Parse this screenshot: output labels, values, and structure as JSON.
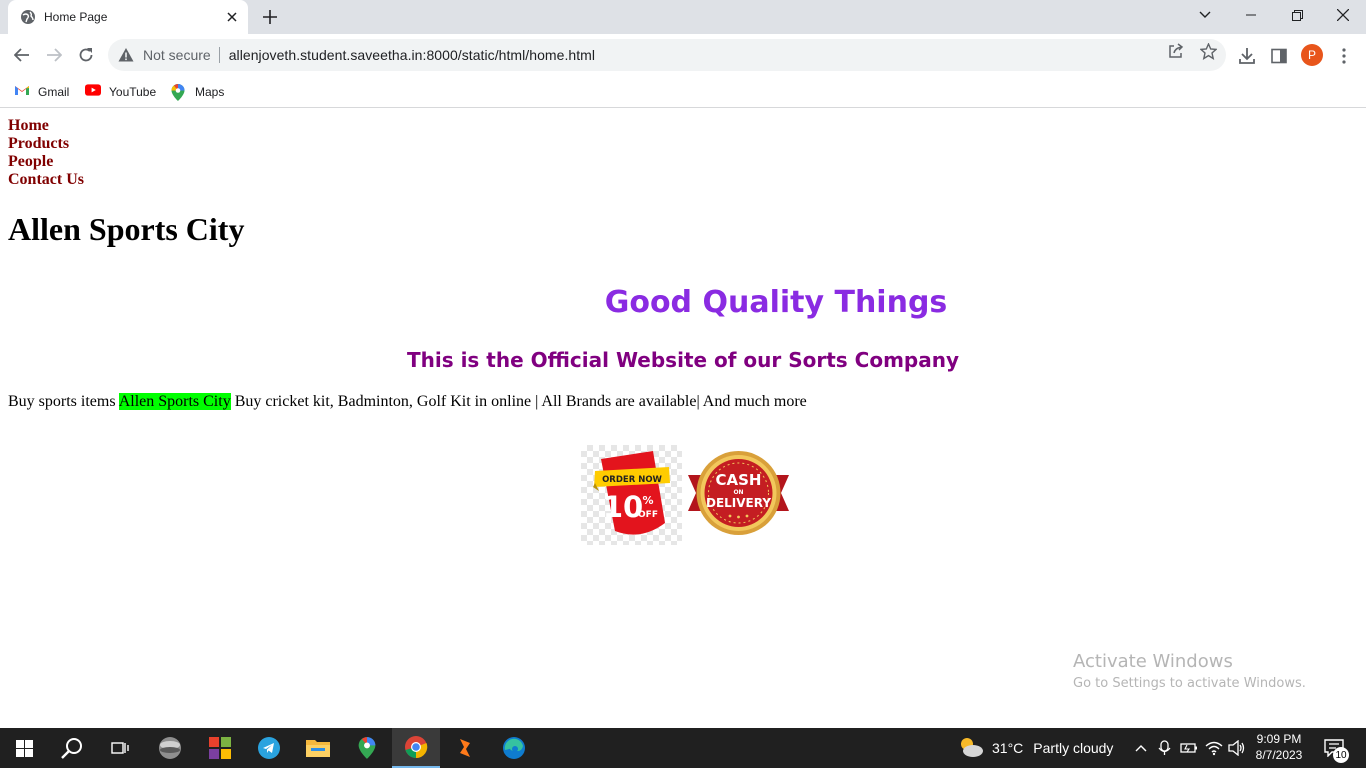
{
  "browser": {
    "tab_title": "Home Page",
    "omnibox": {
      "security_label": "Not secure",
      "url": "allenjoveth.student.saveetha.in:8000/static/html/home.html"
    },
    "profile_initial": "P",
    "bookmarks": [
      {
        "label": "Gmail",
        "icon": "gmail-icon"
      },
      {
        "label": "YouTube",
        "icon": "youtube-icon"
      },
      {
        "label": "Maps",
        "icon": "maps-icon"
      }
    ]
  },
  "page": {
    "nav": [
      "Home",
      "Products",
      "People",
      "Contact Us"
    ],
    "site_title": "Allen Sports City",
    "headline": "Good Quality Things",
    "subheadline": "This is the Official Website of our Sorts Company",
    "paragraph": {
      "before": "Buy sports items ",
      "highlight": "Allen Sports City",
      "after": " Buy cricket kit, Badminton, Golf Kit in online | All Brands are available| And much more"
    },
    "banners": {
      "order": {
        "top": "ORDER NOW",
        "number": "10",
        "percent": "%",
        "suffix": "OFF"
      },
      "cod": {
        "line1": "CASH",
        "line2": "ON",
        "line3": "DELIVERY"
      }
    },
    "colors": {
      "nav_link": "#800000",
      "headline": "#8a2be2",
      "subheadline": "#800080",
      "highlight": "#00ff00"
    }
  },
  "watermark": {
    "title": "Activate Windows",
    "subtitle": "Go to Settings to activate Windows."
  },
  "taskbar": {
    "weather_temp": "31°C",
    "weather_condition": "Partly cloudy",
    "time": "9:09 PM",
    "date": "8/7/2023",
    "notification_count": "10"
  }
}
